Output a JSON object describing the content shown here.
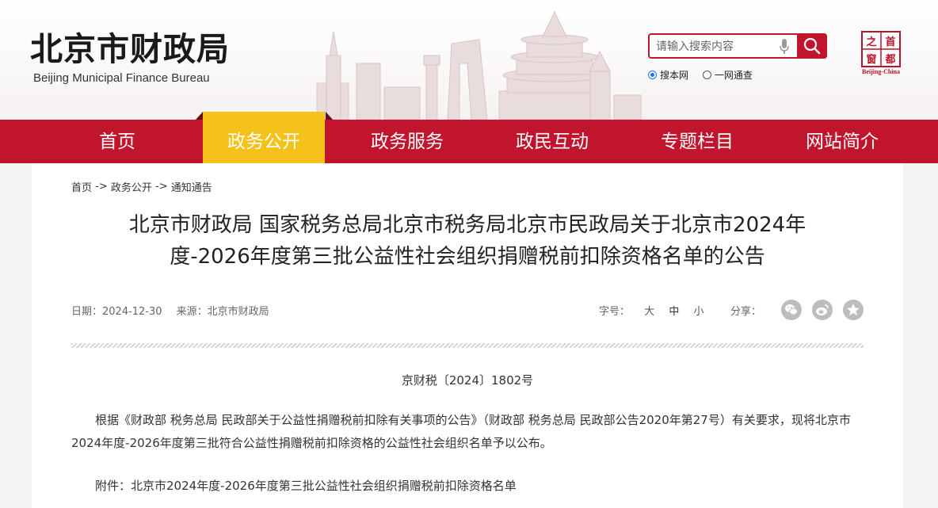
{
  "header": {
    "logo_cn": "北京市财政局",
    "logo_en": "Beijing Municipal Finance Bureau",
    "search": {
      "placeholder": "请输入搜索内容"
    },
    "scope_options": [
      {
        "label": "搜本网",
        "selected": true
      },
      {
        "label": "一网通查",
        "selected": false
      }
    ],
    "badge": {
      "chars": [
        "首",
        "都",
        "之",
        "窗"
      ],
      "caption": "Beijing-China"
    }
  },
  "nav": {
    "items": [
      {
        "label": "首页",
        "active": false
      },
      {
        "label": "政务公开",
        "active": true
      },
      {
        "label": "政务服务",
        "active": false
      },
      {
        "label": "政民互动",
        "active": false
      },
      {
        "label": "专题栏目",
        "active": false
      },
      {
        "label": "网站简介",
        "active": false
      }
    ]
  },
  "breadcrumb": [
    "首页",
    "政务公开",
    "通知通告"
  ],
  "breadcrumb_sep": "->",
  "article": {
    "title_line1": "北京市财政局 国家税务总局北京市税务局北京市民政局关于北京市2024年",
    "title_line2": "度-2026年度第三批公益性社会组织捐赠税前扣除资格名单的公告",
    "date_label": "日期：",
    "date": "2024-12-30",
    "source_label": "来源：",
    "source": "北京市财政局",
    "fontsize_label": "字号：",
    "fontsize_options": [
      "大",
      "中",
      "小"
    ],
    "share_label": "分享：",
    "doc_number": "京财税〔2024〕1802号",
    "paragraph1": "根据《财政部 税务总局 民政部关于公益性捐赠税前扣除有关事项的公告》（财政部 税务总局 民政部公告2020年第27号）有关要求，现将北京市2024年度-2026年度第三批符合公益性捐赠税前扣除资格的公益性社会组织名单予以公布。",
    "attachment": "附件：北京市2024年度-2026年度第三批公益性社会组织捐赠税前扣除资格名单"
  },
  "colors": {
    "brand_red": "#c0152c",
    "active_tab": "#f5c21b",
    "share_icon_gray": "#bdbdbd"
  },
  "icons": [
    "search-icon",
    "microphone-icon",
    "wechat-icon",
    "weibo-icon",
    "favorite-star-icon"
  ]
}
